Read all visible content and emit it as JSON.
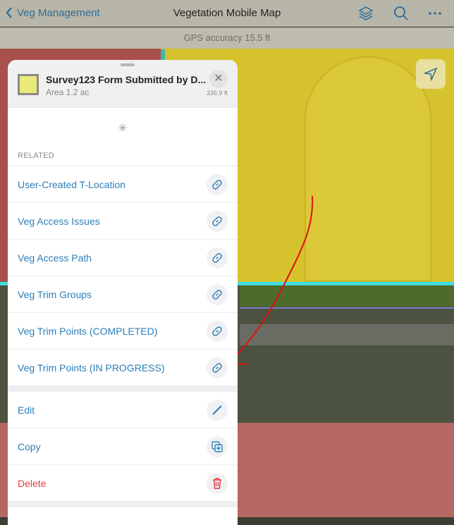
{
  "nav": {
    "back_label": "Veg Management",
    "title": "Vegetation Mobile Map",
    "icons": [
      "layers-icon",
      "search-icon",
      "more-icon"
    ]
  },
  "gps": {
    "text": "GPS accuracy 15.5 ft"
  },
  "panel": {
    "title": "Survey123 Form Submitted by D...",
    "area": "Area 1.2 ac",
    "distance": "336.9 ft",
    "close": "✕",
    "related_header": "RELATED",
    "related": [
      {
        "label": "User-Created T-Location"
      },
      {
        "label": "Veg Access Issues"
      },
      {
        "label": "Veg Access Path"
      },
      {
        "label": "Veg Trim Groups"
      },
      {
        "label": "Veg Trim Points (COMPLETED)"
      },
      {
        "label": "Veg Trim Points (IN PROGRESS)"
      }
    ],
    "actions": {
      "edit": "Edit",
      "copy": "Copy",
      "delete": "Delete"
    }
  },
  "colors": {
    "accent": "#2b7fb8",
    "danger": "#e03b3b",
    "polygon_yellow": "#d9c42c",
    "polygon_red": "#b86a66"
  }
}
